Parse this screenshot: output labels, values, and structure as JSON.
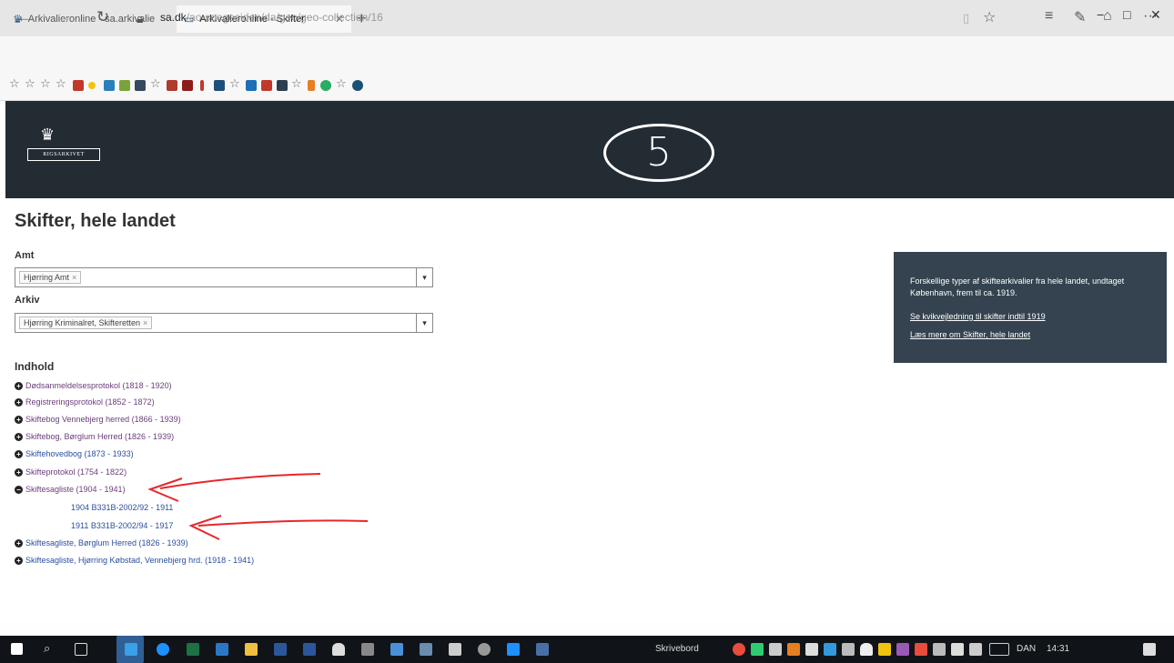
{
  "browser": {
    "tabs": [
      {
        "label": "Arkivalieronline - sa.arkivalie",
        "active": false
      },
      {
        "label": "Arkivalieronline - Skifter",
        "active": true
      }
    ],
    "address": {
      "host": "sa.dk",
      "path": "/ao-soegesiden/da/geo/geo-collection/16"
    },
    "window_controls": {
      "minimize": "−",
      "maximize": "□",
      "close": "✕"
    }
  },
  "site": {
    "logo_text": "RIGSARKIVET",
    "annotation_digit": "5"
  },
  "page": {
    "title": "Skifter, hele landet",
    "amt_label": "Amt",
    "amt_value": "Hjørring Amt",
    "arkiv_label": "Arkiv",
    "arkiv_value": "Hjørring Kriminalret, Skifteretten",
    "indhold_label": "Indhold",
    "entries": [
      {
        "label": "Dødsanmeldelsesprotokol (1818 - 1920)"
      },
      {
        "label": "Registreringsprotokol (1852 - 1872)"
      },
      {
        "label": "Skiftebog Vennebjerg herred (1866 - 1939)"
      },
      {
        "label": "Skiftebog, Børglum Herred (1826 - 1939)"
      },
      {
        "label": "Skiftehovedbog (1873 - 1933)"
      },
      {
        "label": "Skifteprotokol (1754 - 1822)"
      },
      {
        "label": "Skiftesagliste (1904 - 1941)"
      }
    ],
    "subentries": [
      {
        "label": "1904 B331B-2002/92 - 1911"
      },
      {
        "label": "1911 B331B-2002/94 - 1917"
      }
    ],
    "entries_after": [
      {
        "label": "Skiftesagliste, Børglum Herred (1826 - 1939)"
      },
      {
        "label": "Skiftesagliste, Hjørring Købstad, Vennebjerg hrd. (1918 - 1941)"
      }
    ]
  },
  "info_panel": {
    "text": "Forskellige typer af skiftearkivalier fra hele landet, undtaget København, frem til ca. 1919.",
    "link1": "Se kvikvejledning til skifter indtil 1919",
    "link2": "Læs mere om Skifter, hele landet"
  },
  "taskbar": {
    "search_text": "Skrivebord",
    "language": "DAN",
    "time": "14:31"
  }
}
